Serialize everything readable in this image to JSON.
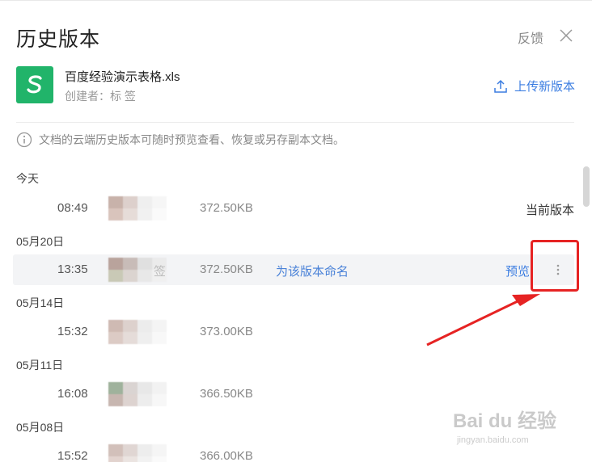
{
  "dialog": {
    "title": "历史版本",
    "feedback": "反馈"
  },
  "file": {
    "icon_letter": "S",
    "name": "百度经验演示表格.xls",
    "creator": "创建者：标 签",
    "upload_label": "上传新版本",
    "brand_color": "#21b46a"
  },
  "notice": "文档的云端历史版本可随时预览查看、恢复或另存副本文档。",
  "groups": [
    {
      "date": "今天",
      "rows": [
        {
          "time": "08:49",
          "size": "372.50KB",
          "status": "当前版本"
        }
      ]
    },
    {
      "date": "05月20日",
      "rows": [
        {
          "time": "13:35",
          "size": "372.50KB",
          "name_link": "为该版本命名",
          "preview": "预览",
          "avatar_text": "签"
        }
      ]
    },
    {
      "date": "05月14日",
      "rows": [
        {
          "time": "15:32",
          "size": "373.00KB"
        }
      ]
    },
    {
      "date": "05月11日",
      "rows": [
        {
          "time": "16:08",
          "size": "366.50KB"
        }
      ]
    },
    {
      "date": "05月08日",
      "rows": [
        {
          "time": "15:52",
          "size": "366.00KB"
        }
      ]
    }
  ],
  "watermark": {
    "logo": "Bai du 经验",
    "url": "jingyan.baidu.com"
  },
  "colors": {
    "accent": "#3b7de1",
    "annotation": "#e62323"
  }
}
